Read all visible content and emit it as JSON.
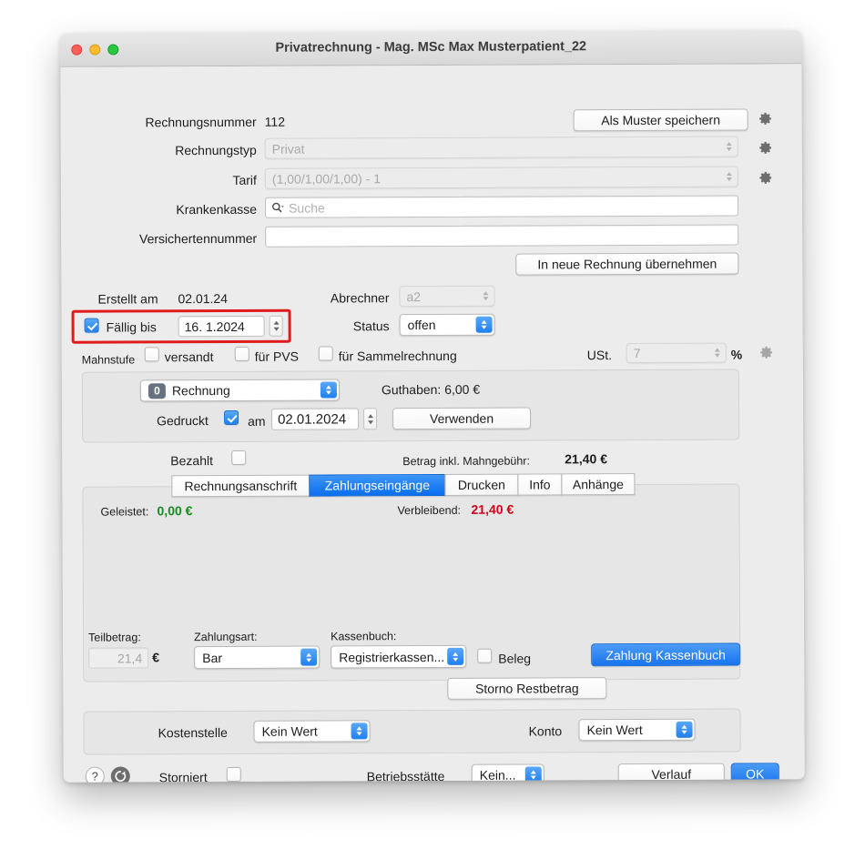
{
  "window": {
    "title": "Privatrechnung - Mag. MSc Max Musterpatient_22",
    "traffic_lights": {
      "close": "close-button",
      "minimize": "minimize-button",
      "maximize": "maximize-button"
    }
  },
  "form": {
    "rechnungsnummer_label": "Rechnungsnummer",
    "rechnungsnummer_value": "112",
    "save_as_template_button": "Als Muster speichern",
    "rechnungstyp_label": "Rechnungstyp",
    "rechnungstyp_value": "Privat",
    "tarif_label": "Tarif",
    "tarif_value": "(1,00/1,00/1,00) - 1",
    "krankenkasse_label": "Krankenkasse",
    "krankenkasse_placeholder": "Suche",
    "versichertennummer_label": "Versichertennummer",
    "versichertennummer_value": "",
    "transfer_button": "In neue Rechnung übernehmen"
  },
  "dates": {
    "erstellt_label": "Erstellt am",
    "erstellt_value": "02.01.24",
    "faellig_label": "Fällig bis",
    "faellig_value": "16.  1.2024",
    "faellig_checked": true,
    "abrechner_label": "Abrechner",
    "abrechner_value": "a2",
    "status_label": "Status",
    "status_value": "offen"
  },
  "mahnstufe": {
    "label": "Mahnstufe",
    "versandt_label": "versandt",
    "pvs_label": "für PVS",
    "sammelrechnung_label": "für Sammelrechnung",
    "ust_label": "USt.",
    "ust_value": "7",
    "percent_label": "%"
  },
  "printpanel": {
    "doctype_badge": "0",
    "doctype_value": "Rechnung",
    "guthaben_label": "Guthaben: 6,00 €",
    "gedruckt_label": "Gedruckt",
    "gedruckt_checked": true,
    "am_label": "am",
    "gedruckt_date": "02.01.2024",
    "verwenden_button": "Verwenden"
  },
  "payment": {
    "bezahlt_label": "Bezahlt",
    "bezahlt_checked": false,
    "betrag_label": "Betrag inkl. Mahngebühr:",
    "betrag_value": "21,40 €"
  },
  "tabs": [
    {
      "label": "Rechnungsanschrift",
      "active": false
    },
    {
      "label": "Zahlungseingänge",
      "active": true
    },
    {
      "label": "Drucken",
      "active": false
    },
    {
      "label": "Info",
      "active": false
    },
    {
      "label": "Anhänge",
      "active": false
    }
  ],
  "tabpanel": {
    "geleistet_label": "Geleistet:",
    "geleistet_value": "0,00 €",
    "verbleibend_label": "Verbleibend:",
    "verbleibend_value": "21,40 €",
    "teilbetrag_label": "Teilbetrag:",
    "teilbetrag_value": "21,4",
    "euro_label": "€",
    "zahlungsart_label": "Zahlungsart:",
    "zahlungsart_value": "Bar",
    "kassenbuch_label": "Kassenbuch:",
    "kassenbuch_value": "Registrierkassen...",
    "beleg_label": "Beleg",
    "beleg_checked": false,
    "zahlung_kassenbuch_button": "Zahlung Kassenbuch",
    "storno_restbetrag_button": "Storno Restbetrag"
  },
  "accounting": {
    "kostenstelle_label": "Kostenstelle",
    "kostenstelle_value": "Kein Wert",
    "konto_label": "Konto",
    "konto_value": "Kein Wert"
  },
  "footer": {
    "help_icon": "?",
    "storniert_label": "Storniert",
    "storniert_checked": false,
    "betriebsstaette_label": "Betriebsstätte",
    "betriebsstaette_value": "Kein...",
    "verlauf_button": "Verlauf",
    "ok_button": "OK"
  },
  "colors": {
    "accent_blue": "#1f7ff0",
    "annotation_red": "#e01b1b",
    "green_text": "#1a8a23",
    "red_text": "#d0021b",
    "window_bg": "#ececec"
  }
}
